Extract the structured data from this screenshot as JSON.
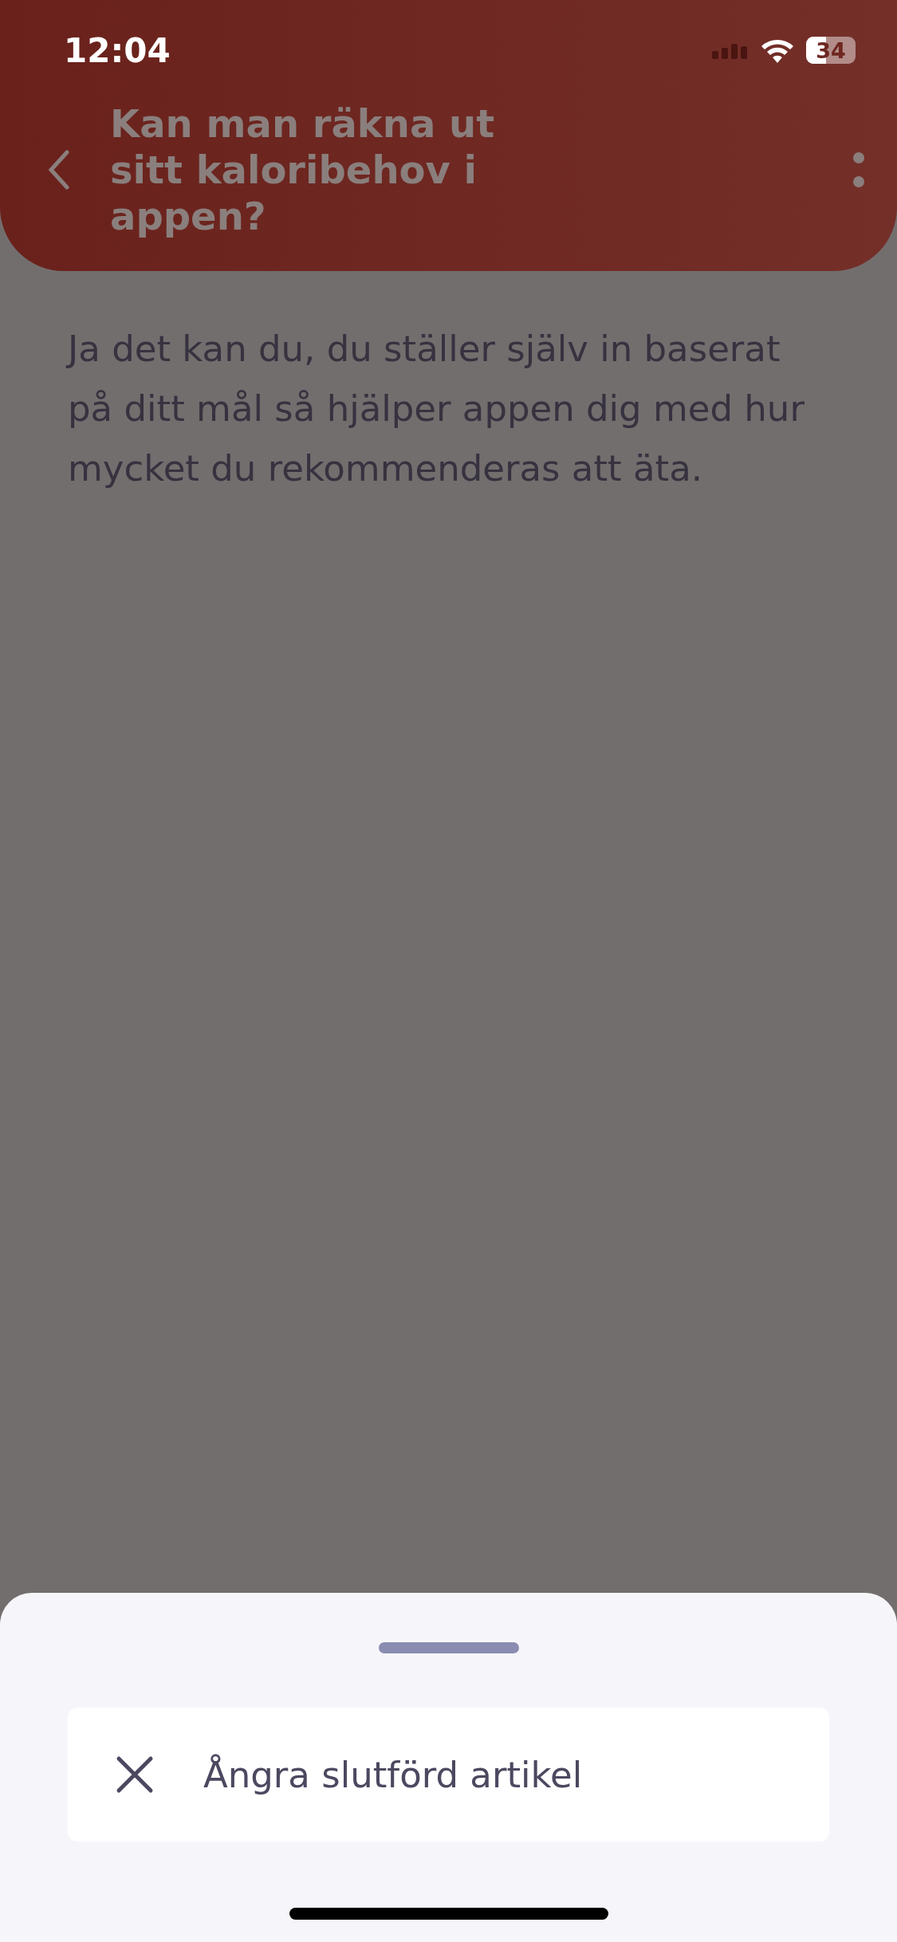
{
  "status_bar": {
    "time": "12:04",
    "battery": "34"
  },
  "header": {
    "title": "Kan man räkna ut sitt kaloribehov i appen?"
  },
  "article": {
    "body": "Ja det kan du, du ställer själv in baserat på ditt mål så hjälper appen dig med hur mycket du rekommenderas att äta."
  },
  "sheet": {
    "actions": [
      {
        "label": "Ångra slutförd artikel",
        "kind": "undo"
      }
    ]
  }
}
